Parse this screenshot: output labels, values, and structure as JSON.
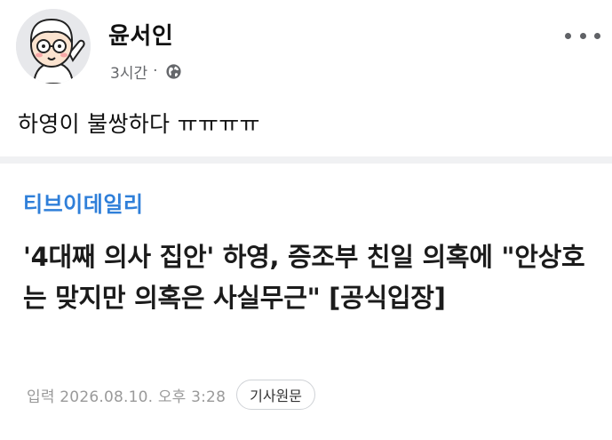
{
  "post": {
    "author": "윤서인",
    "time": "3시간",
    "separator": "·",
    "privacy_icon": "globe-icon",
    "more_icon": "more-dots-icon",
    "text": "하영이 불쌍하다 ㅠㅠㅠㅠ"
  },
  "article": {
    "outlet": "티브이데일리",
    "headline": "'4대째 의사 집안' 하영, 증조부 친일 의혹에 \"안상호는 맞지만 의혹은 사실무근\" [공식입장]",
    "date": "입력 2026.08.10. 오후 3:28",
    "original_button": "기사원문"
  },
  "colors": {
    "outlet": "#2f7fd9",
    "muted": "#65676b",
    "divider": "#f0f1f3"
  }
}
